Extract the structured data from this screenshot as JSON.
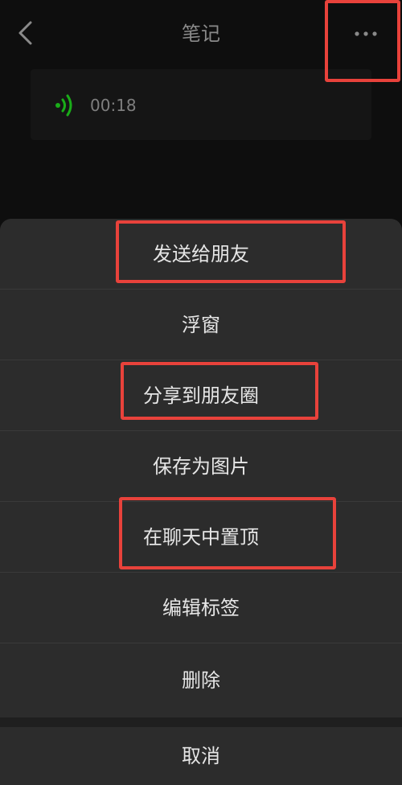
{
  "nav": {
    "title": "笔记",
    "back_icon": "chevron-left-icon",
    "more_icon": "more-dots-icon"
  },
  "voice_note": {
    "icon": "voice-wave-icon",
    "duration": "00:18",
    "accent": "#1aad19"
  },
  "menu": {
    "items": [
      {
        "label": "发送给朋友"
      },
      {
        "label": "浮窗"
      },
      {
        "label": "分享到朋友圈"
      },
      {
        "label": "保存为图片"
      },
      {
        "label": "在聊天中置顶"
      },
      {
        "label": "编辑标签"
      },
      {
        "label": "删除"
      }
    ],
    "cancel_label": "取消"
  },
  "annotation_color": "#e8423b"
}
